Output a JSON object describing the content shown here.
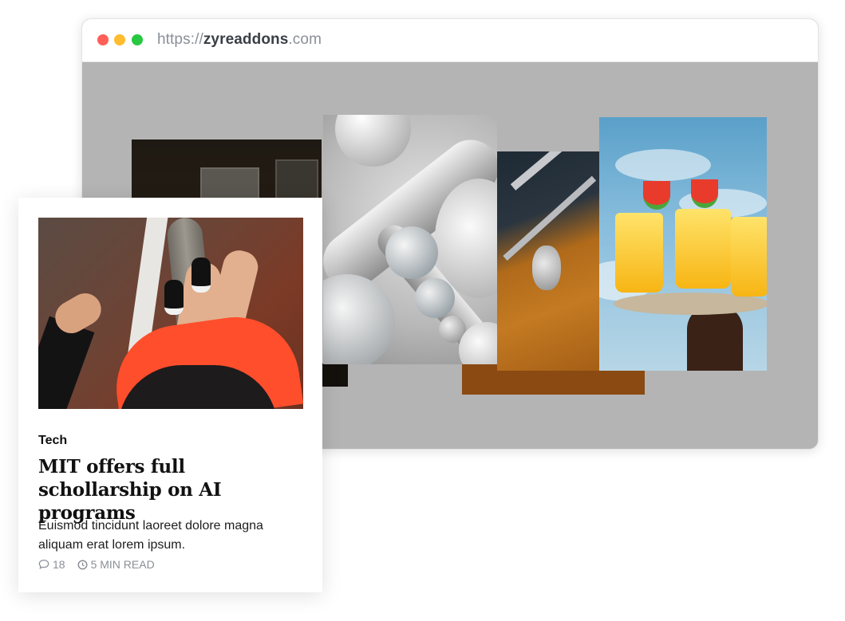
{
  "browser": {
    "url_prefix": "https://",
    "url_domain": "zyreaddons",
    "url_suffix": ".com"
  },
  "gallery": {
    "images": [
      {
        "name": "dark-interior-image"
      },
      {
        "name": "metal-spheres-image"
      },
      {
        "name": "orange-car-image"
      },
      {
        "name": "drinks-tray-image"
      }
    ]
  },
  "card": {
    "category": "Tech",
    "title": "MIT offers full schollarship on AI programs",
    "excerpt": "Euismod tincidunt laoreet dolore magna aliquam erat lorem ipsum.",
    "comments": "18",
    "read_time": "5 MIN READ",
    "icons": {
      "comments": "comment-icon",
      "read_time": "clock-icon"
    }
  }
}
